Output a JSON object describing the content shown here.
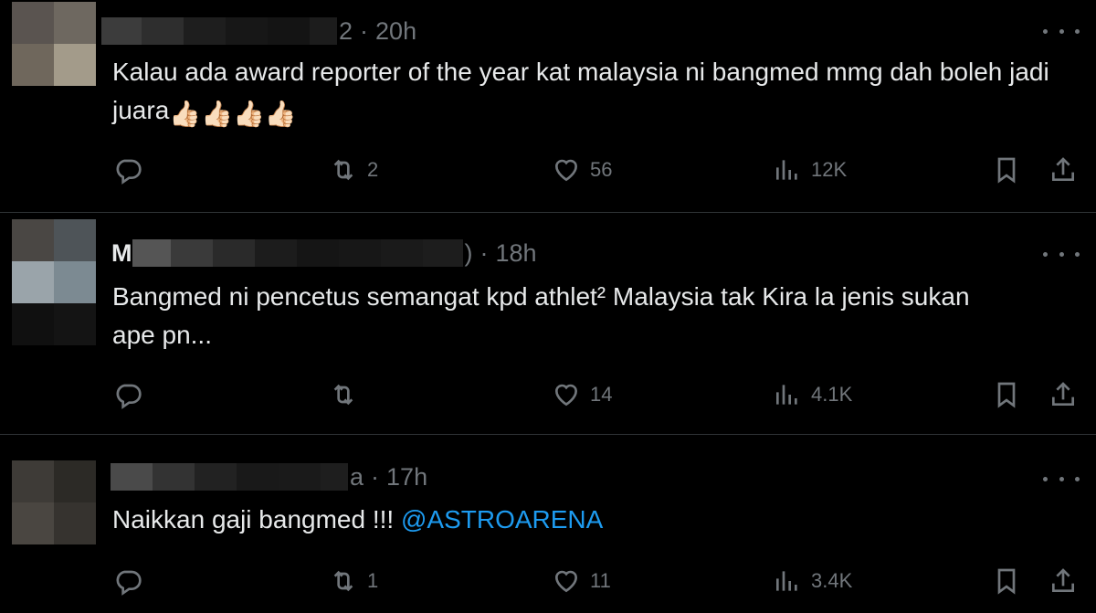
{
  "tweets": [
    {
      "handle_tail": "2",
      "time": "20h",
      "text": "Kalau ada award reporter of the year kat malaysia ni bangmed mmg dah boleh jadi juara",
      "emojis": "👍🏻👍🏻👍🏻👍🏻",
      "replies": "",
      "retweets": "2",
      "likes": "56",
      "views": "12K"
    },
    {
      "name_initial": "M",
      "handle_tail": ")",
      "time": "18h",
      "text_line1": "Bangmed ni pencetus semangat kpd athlet² Malaysia tak Kira la jenis sukan",
      "text_line2": "ape pn...",
      "replies": "",
      "retweets": "",
      "likes": "14",
      "views": "4.1K"
    },
    {
      "handle_tail": "a",
      "time": "17h",
      "text": "Naikkan gaji bangmed !!! ",
      "mention": "@ASTROARENA",
      "replies": "",
      "retweets": "1",
      "likes": "11",
      "views": "3.4K"
    }
  ],
  "icons": {
    "reply": "reply-icon",
    "retweet": "retweet-icon",
    "like": "heart-icon",
    "views": "views-icon",
    "bookmark": "bookmark-icon",
    "share": "share-icon",
    "more": "more-icon"
  },
  "colors": {
    "background": "#000000",
    "text": "#e7e9ea",
    "muted": "#71767b",
    "link": "#1d9bf0",
    "divider": "#2f3336"
  }
}
